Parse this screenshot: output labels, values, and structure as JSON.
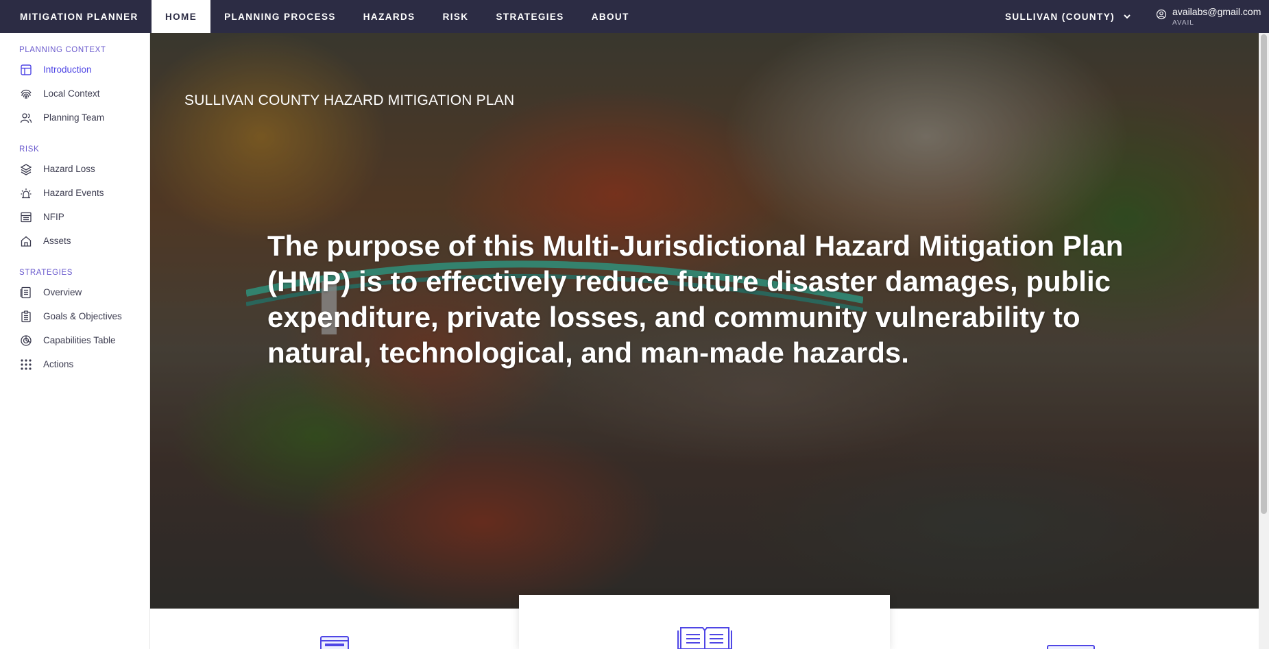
{
  "topnav": {
    "brand": "MITIGATION PLANNER",
    "tabs": [
      {
        "label": "HOME",
        "active": true
      },
      {
        "label": "PLANNING PROCESS",
        "active": false
      },
      {
        "label": "HAZARDS",
        "active": false
      },
      {
        "label": "RISK",
        "active": false
      },
      {
        "label": "STRATEGIES",
        "active": false
      },
      {
        "label": "ABOUT",
        "active": false
      }
    ],
    "county_select": "SULLIVAN (COUNTY)",
    "user": {
      "email": "availabs@gmail.com",
      "org": "AVAIL"
    }
  },
  "sidebar": {
    "sections": [
      {
        "title": "PLANNING CONTEXT",
        "items": [
          {
            "label": "Introduction",
            "icon": "layout-icon",
            "active": true
          },
          {
            "label": "Local Context",
            "icon": "fingerprint-icon",
            "active": false
          },
          {
            "label": "Planning Team",
            "icon": "users-icon",
            "active": false
          }
        ]
      },
      {
        "title": "RISK",
        "items": [
          {
            "label": "Hazard Loss",
            "icon": "layers-icon",
            "active": false
          },
          {
            "label": "Hazard Events",
            "icon": "alarm-icon",
            "active": false
          },
          {
            "label": "NFIP",
            "icon": "archive-icon",
            "active": false
          },
          {
            "label": "Assets",
            "icon": "home-icon",
            "active": false
          }
        ]
      },
      {
        "title": "STRATEGIES",
        "items": [
          {
            "label": "Overview",
            "icon": "document-icon",
            "active": false
          },
          {
            "label": "Goals & Objectives",
            "icon": "checklist-icon",
            "active": false
          },
          {
            "label": "Capabilities Table",
            "icon": "pie-icon",
            "active": false
          },
          {
            "label": "Actions",
            "icon": "grid-dots-icon",
            "active": false
          }
        ]
      }
    ]
  },
  "hero": {
    "title": "SULLIVAN COUNTY HAZARD MITIGATION PLAN",
    "purpose": "The purpose of this Multi-Jurisdictional Hazard Mitigation Plan (HMP) is to effectively reduce future disaster damages, public expenditure, private losses, and community vulnerability to natural, technological, and man-made hazards."
  },
  "colors": {
    "nav_bg": "#2c2c44",
    "accent": "#4f46e5",
    "section_label": "#6a5acd"
  }
}
